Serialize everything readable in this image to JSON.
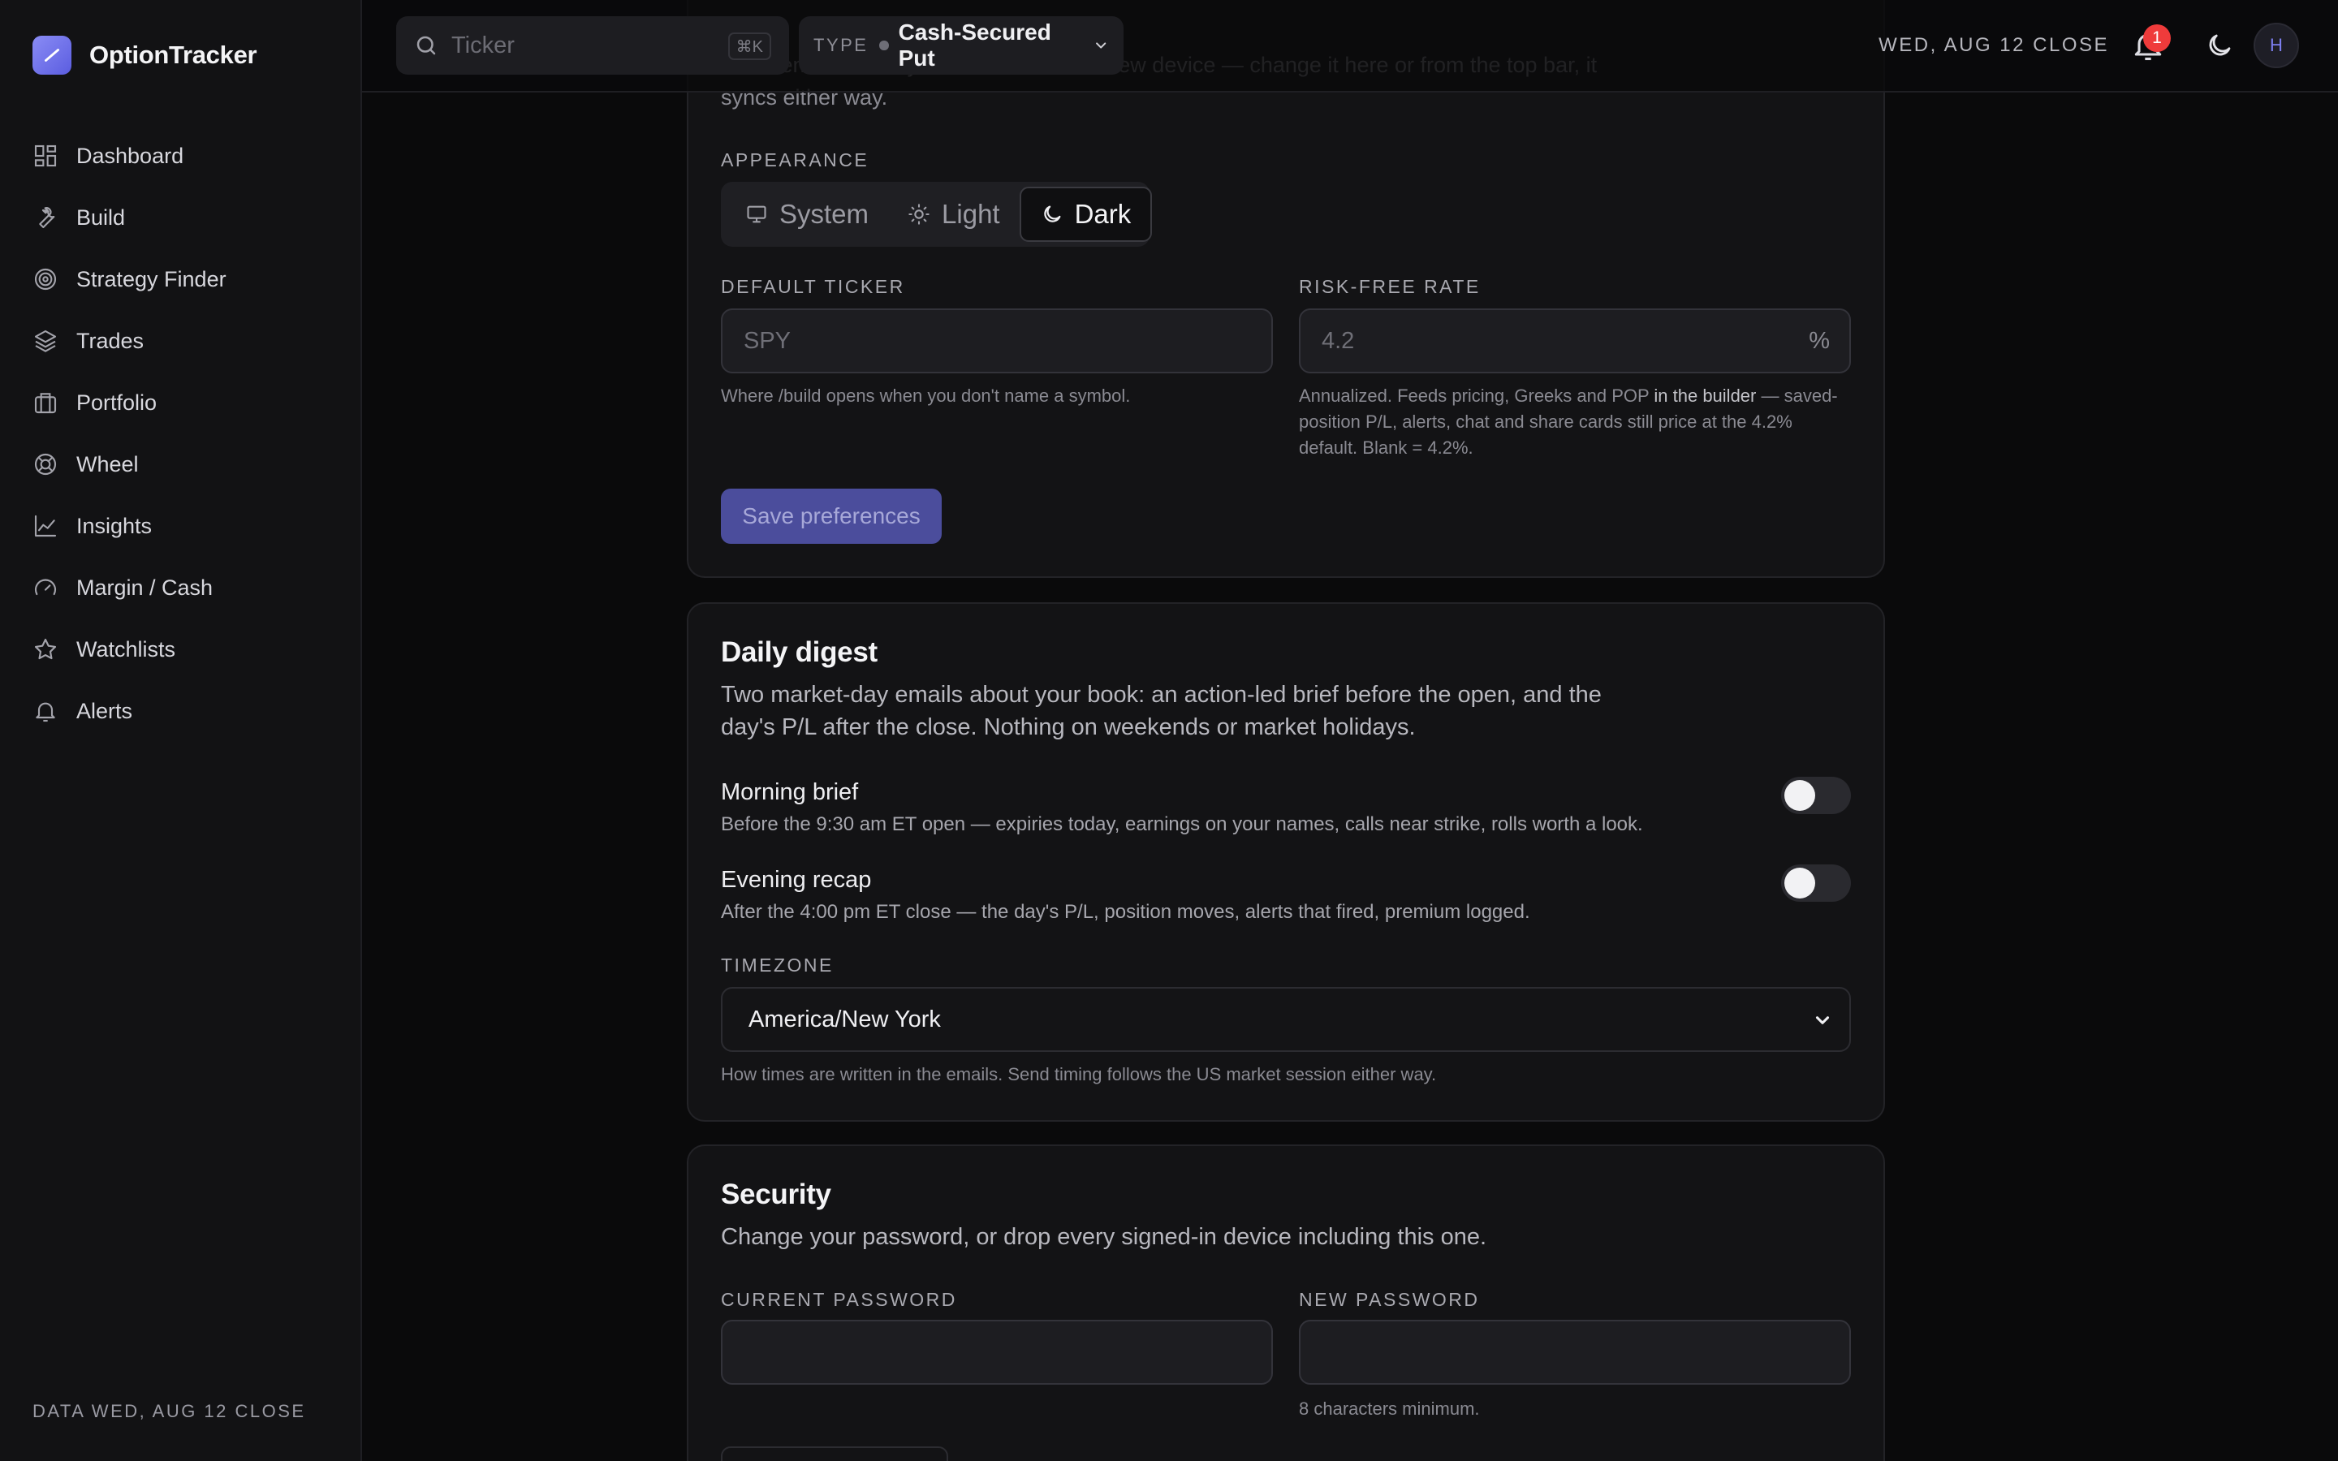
{
  "app": {
    "name": "OptionTracker"
  },
  "sidebar": {
    "items": [
      {
        "label": "Dashboard",
        "icon": "dashboard-icon"
      },
      {
        "label": "Build",
        "icon": "wrench-icon"
      },
      {
        "label": "Strategy Finder",
        "icon": "target-icon"
      },
      {
        "label": "Trades",
        "icon": "layers-icon"
      },
      {
        "label": "Portfolio",
        "icon": "briefcase-icon"
      },
      {
        "label": "Wheel",
        "icon": "lifebuoy-icon"
      },
      {
        "label": "Insights",
        "icon": "line-chart-icon"
      },
      {
        "label": "Margin / Cash",
        "icon": "gauge-icon"
      },
      {
        "label": "Watchlists",
        "icon": "star-icon"
      },
      {
        "label": "Alerts",
        "icon": "bell-icon"
      }
    ],
    "footer": "DATA WED, AUG 12 CLOSE"
  },
  "topbar": {
    "search_placeholder": "Ticker",
    "search_shortcut": "⌘K",
    "type_label": "TYPE",
    "type_value": "Cash-Secured Put",
    "date": "WED, AUG 12 CLOSE",
    "notification_count": "1",
    "avatar_initial": "H"
  },
  "preferences": {
    "faded_text": "Preference follows your account onto a new device — change it here or from the top bar, it syncs either way.",
    "appearance_label": "APPEARANCE",
    "appearance_options": [
      "System",
      "Light",
      "Dark"
    ],
    "appearance_selected": "Dark",
    "default_ticker_label": "DEFAULT TICKER",
    "default_ticker_placeholder": "SPY",
    "default_ticker_help": "Where /build opens when you don't name a symbol.",
    "risk_free_label": "RISK-FREE RATE",
    "risk_free_placeholder": "4.2",
    "risk_free_unit": "%",
    "risk_free_help_1": "Annualized. Feeds pricing, Greeks and POP ",
    "risk_free_help_bold": "in the builder",
    "risk_free_help_2": " — saved-position P/L, alerts, chat and share cards still price at the 4.2% default. Blank = 4.2%.",
    "save_button": "Save preferences"
  },
  "digest": {
    "title": "Daily digest",
    "subtitle": "Two market-day emails about your book: an action-led brief before the open, and the day's P/L after the close. Nothing on weekends or market holidays.",
    "morning_title": "Morning brief",
    "morning_desc": "Before the 9:30 am ET open — expiries today, earnings on your names, calls near strike, rolls worth a look.",
    "morning_enabled": false,
    "evening_title": "Evening recap",
    "evening_desc": "After the 4:00 pm ET close — the day's P/L, position moves, alerts that fired, premium logged.",
    "evening_enabled": false,
    "timezone_label": "TIMEZONE",
    "timezone_value": "America/New York",
    "timezone_help": "How times are written in the emails. Send timing follows the US market session either way."
  },
  "security": {
    "title": "Security",
    "subtitle": "Change your password, or drop every signed-in device including this one.",
    "current_password_label": "CURRENT PASSWORD",
    "new_password_label": "NEW PASSWORD",
    "new_password_help": "8 characters minimum."
  },
  "colors": {
    "accent": "#5b5de0",
    "background": "#0a0a0b",
    "card": "#131315",
    "badge": "#ef3b3b"
  }
}
